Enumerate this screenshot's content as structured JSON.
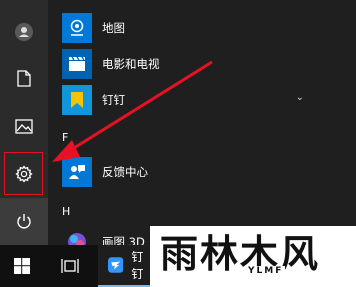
{
  "start_menu": {
    "rail": {
      "icons": [
        "user-avatar-icon",
        "document-icon",
        "pictures-icon",
        "settings-gear-icon",
        "power-icon"
      ]
    },
    "apps": [
      {
        "label": "地图",
        "icon": "map-icon",
        "tile_color": "#0078d7"
      },
      {
        "label": "电影和电视",
        "icon": "film-icon",
        "tile_color": "#0063b1"
      },
      {
        "label": "钉钉",
        "icon": "bookmark-icon",
        "tile_color": "#1296db"
      },
      {
        "label": "反馈中心",
        "icon": "feedback-icon",
        "tile_color": "#0078d7"
      },
      {
        "label": "画图 3D",
        "icon": "paint3d-icon",
        "tile_color": "#2b2b2b"
      }
    ],
    "group_letters": {
      "f": "F",
      "h": "H"
    },
    "expand_glyph": "⌄"
  },
  "annotation": {
    "arrow_color": "#e81123",
    "highlight_color": "#e81123"
  },
  "taskbar": {
    "icons": [
      "windows-logo-icon",
      "task-view-icon",
      "dingtalk-icon"
    ],
    "active_item_label": "钉钉"
  },
  "watermark": {
    "text": "雨林木风",
    "subtext": "YLMF"
  }
}
